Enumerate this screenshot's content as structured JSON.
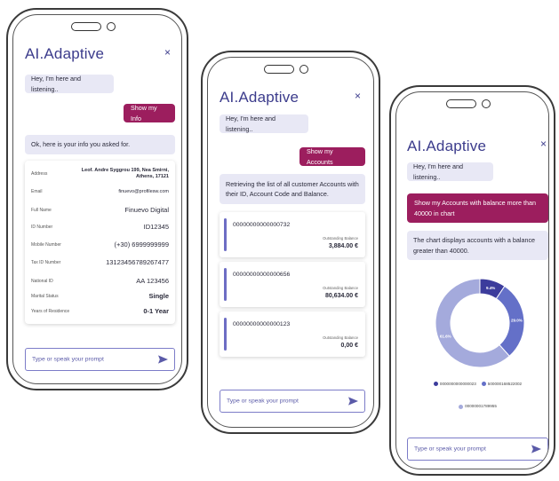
{
  "colors": {
    "accent": "#9c1e5e",
    "primary": "#3c3c8c",
    "bot_bubble": "#e8e8f5",
    "account_bar": "#6d6dc4"
  },
  "icons": {
    "close": "close-icon",
    "send": "send-arrow-icon"
  },
  "screen1": {
    "title": "AI.Adaptive",
    "close": "×",
    "greeting": "Hey, I'm here and listening..",
    "user_msg": "Show my Info",
    "bot_reply": "Ok, here is your info you asked for.",
    "info": [
      {
        "label": "Address",
        "value": "Leof. Andre Syggrou 199, Nea Smirni, Athens, 17121"
      },
      {
        "label": "Email",
        "value": "finuevo@profilesw.com"
      },
      {
        "label": "Full Name",
        "value": "Finuevo Digital"
      },
      {
        "label": "ID Number",
        "value": "ID12345"
      },
      {
        "label": "Mobile Number",
        "value": "(+30) 6999999999"
      },
      {
        "label": "Tax ID Number",
        "value": "13123456789267477"
      },
      {
        "label": "National ID",
        "value": "AA 123456"
      },
      {
        "label": "Marital Status",
        "value": "Single"
      },
      {
        "label": "Years of Residence",
        "value": "0-1 Year"
      }
    ],
    "prompt_placeholder": "Type or speak your prompt"
  },
  "screen2": {
    "title": "AI.Adaptive",
    "close": "×",
    "greeting": "Hey, I'm here and listening..",
    "user_msg": "Show my Accounts",
    "bot_reply": "Retrieving the list of all customer Accounts with their ID, Account Code and Balance.",
    "accounts": [
      {
        "code": "00000000000000732",
        "balance_label": "Outstanding Balance",
        "balance": "3,884.00 €"
      },
      {
        "code": "00000000000000656",
        "balance_label": "Outstanding Balance",
        "balance": "80,634.00 €"
      },
      {
        "code": "00000000000000123",
        "balance_label": "Outstanding Balance",
        "balance": "0,00 €"
      }
    ],
    "prompt_placeholder": "Type or speak your prompt"
  },
  "screen3": {
    "title": "AI.Adaptive",
    "close": "×",
    "greeting": "Hey, I'm here and listening..",
    "user_msg": "Show my Accounts with balance more than 40000 in chart",
    "bot_reply": "The chart displays accounts with a balance greater than 40000.",
    "prompt_placeholder": "Type or speak your prompt"
  },
  "chart_data": {
    "type": "pie",
    "donut": true,
    "slices": [
      {
        "name": "0000000000000023",
        "percent": 9.4,
        "label": "9.4%",
        "color": "#3c3c9c"
      },
      {
        "name": "500000168522002",
        "percent": 29.0,
        "label": "29.0%",
        "color": "#6470c8"
      },
      {
        "name": "00000001789955",
        "percent": 61.6,
        "label": "61.6%",
        "color": "#a4aadc"
      }
    ],
    "legend_position": "bottom"
  }
}
